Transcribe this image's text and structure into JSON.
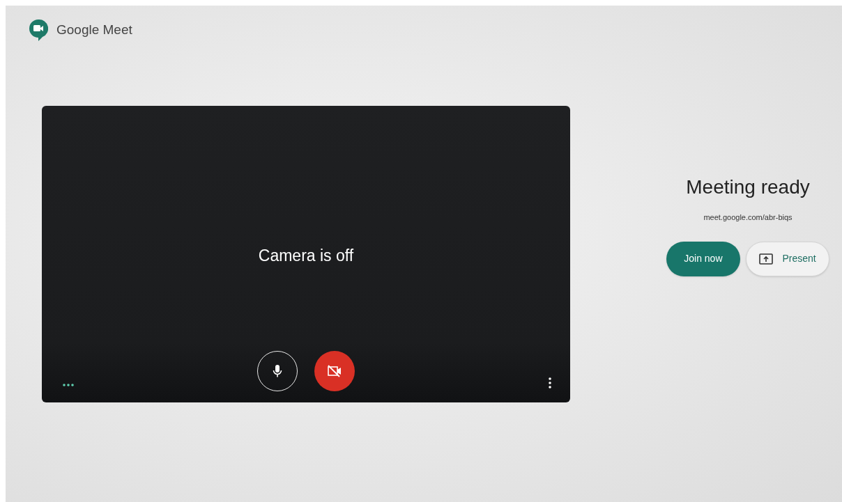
{
  "app": {
    "title": "Google Meet"
  },
  "preview": {
    "message": "Camera is off",
    "microphone": {
      "on": true
    },
    "camera": {
      "on": false
    }
  },
  "meeting": {
    "title": "Meeting ready",
    "link": "meet.google.com/abr-biqs"
  },
  "buttons": [
    {
      "kind": "primary",
      "label": "Join now"
    },
    {
      "kind": "present",
      "label": "Present"
    }
  ]
}
